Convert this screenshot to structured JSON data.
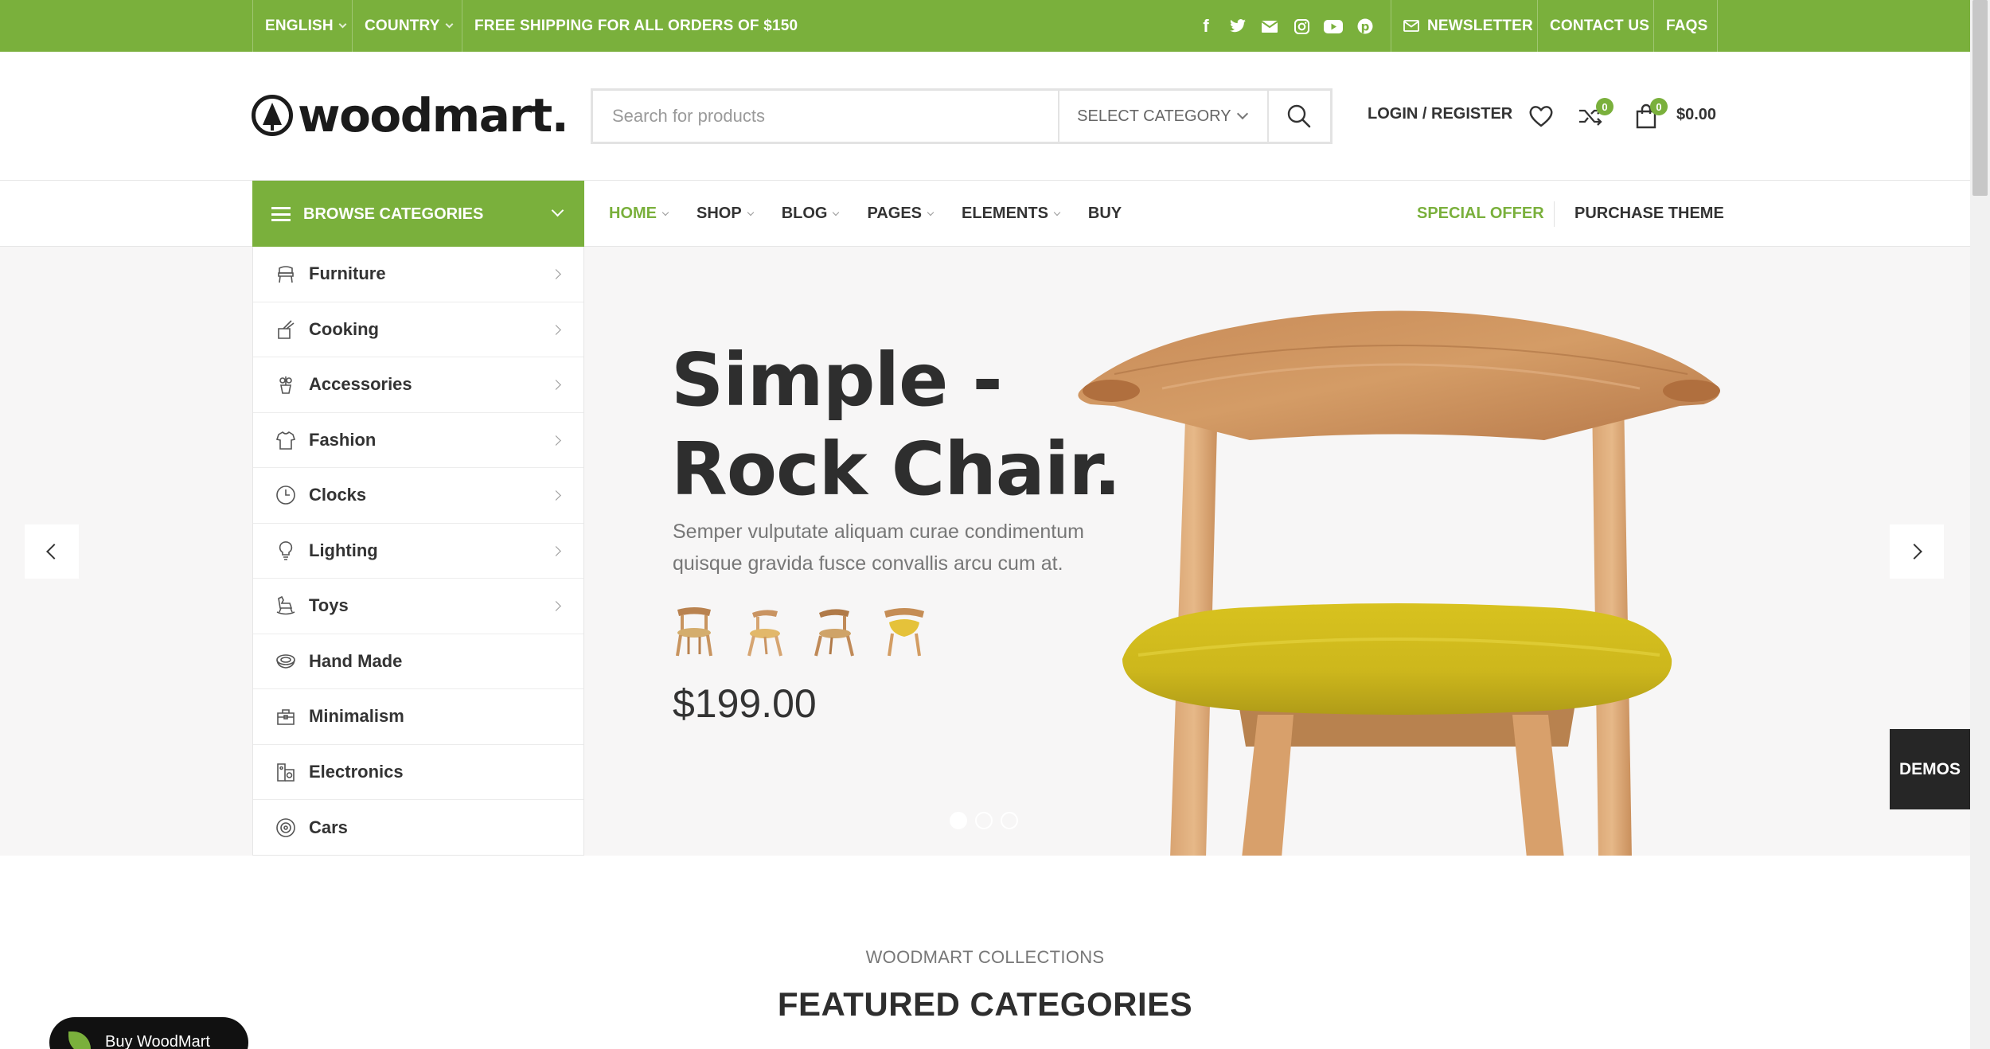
{
  "topbar": {
    "language": "ENGLISH",
    "country": "COUNTRY",
    "shipping": "FREE SHIPPING FOR ALL ORDERS OF $150",
    "social": [
      "facebook-icon",
      "twitter-icon",
      "email-icon",
      "instagram-icon",
      "youtube-icon",
      "pinterest-icon"
    ],
    "newsletter": "NEWSLETTER",
    "contact": "CONTACT US",
    "faqs": "FAQS"
  },
  "header": {
    "logo_text": "woodmart.",
    "search_placeholder": "Search for products",
    "select_category": "SELECT CATEGORY",
    "login": "LOGIN / REGISTER",
    "compare_count": "0",
    "cart_count": "0",
    "cart_total": "$0.00"
  },
  "nav": {
    "browse": "BROWSE CATEGORIES",
    "items": [
      {
        "label": "HOME",
        "active": true,
        "dropdown": true
      },
      {
        "label": "SHOP",
        "active": false,
        "dropdown": true
      },
      {
        "label": "BLOG",
        "active": false,
        "dropdown": true
      },
      {
        "label": "PAGES",
        "active": false,
        "dropdown": true
      },
      {
        "label": "ELEMENTS",
        "active": false,
        "dropdown": true
      },
      {
        "label": "BUY",
        "active": false,
        "dropdown": false
      }
    ],
    "special_offer": "SPECIAL OFFER",
    "purchase_theme": "PURCHASE THEME"
  },
  "categories": [
    {
      "label": "Furniture",
      "icon": "chair-icon",
      "has_sub": true
    },
    {
      "label": "Cooking",
      "icon": "cooking-icon",
      "has_sub": true
    },
    {
      "label": "Accessories",
      "icon": "accessories-icon",
      "has_sub": true
    },
    {
      "label": "Fashion",
      "icon": "shirt-icon",
      "has_sub": true
    },
    {
      "label": "Clocks",
      "icon": "clock-icon",
      "has_sub": true
    },
    {
      "label": "Lighting",
      "icon": "bulb-icon",
      "has_sub": true
    },
    {
      "label": "Toys",
      "icon": "rocking-horse-icon",
      "has_sub": true
    },
    {
      "label": "Hand Made",
      "icon": "basket-icon",
      "has_sub": false
    },
    {
      "label": "Minimalism",
      "icon": "bag-icon",
      "has_sub": false
    },
    {
      "label": "Electronics",
      "icon": "electronics-icon",
      "has_sub": false
    },
    {
      "label": "Cars",
      "icon": "wheel-icon",
      "has_sub": false
    }
  ],
  "hero": {
    "title_line1": "Simple -",
    "title_line2": "Rock Chair.",
    "description": "Semper vulputate aliquam curae condimentum quisque gravida fusce convallis arcu cum at.",
    "price": "$199.00",
    "active_slide": 1,
    "slide_count": 3
  },
  "demos": "DEMOS",
  "featured": {
    "subtitle": "WOODMART COLLECTIONS",
    "title": "FEATURED CATEGORIES"
  },
  "buy_button": "Buy WoodMart",
  "colors": {
    "brand_green": "#7ab03c",
    "dark": "#2e2e2e",
    "hero_bg": "#f7f6f6"
  }
}
